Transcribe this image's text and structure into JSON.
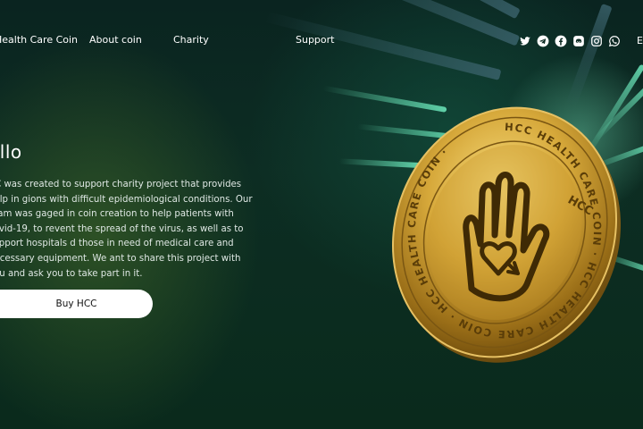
{
  "nav": {
    "brand": "Health Care Coin",
    "links": [
      "About coin",
      "Charity",
      "Support"
    ],
    "language": "E",
    "social_icons": [
      "twitter-icon",
      "telegram-icon",
      "facebook-icon",
      "discord-icon",
      "instagram-icon",
      "whatsapp-icon"
    ]
  },
  "hero": {
    "title": "ello",
    "text": "CC was created to support charity project that provides help in gions with difficult epidemiological conditions. Our team was gaged in coin creation to help patients with covid-19, to revent the spread of the virus, as well as to support hospitals d those in need of medical care and necessary equipment. We ant to share this project with you and ask you to take part in it.",
    "button_label": "Buy HCC"
  },
  "coin": {
    "ring_text": "HCC HEALTH CARE COIN · HCC HEALTH CARE COIN · HCC HEALTH CARE COIN ·",
    "badge_text": "HCC"
  },
  "colors": {
    "accent": "#6fe6b9",
    "coin_gold": "#d6a83a",
    "button_bg": "#ffffff"
  }
}
